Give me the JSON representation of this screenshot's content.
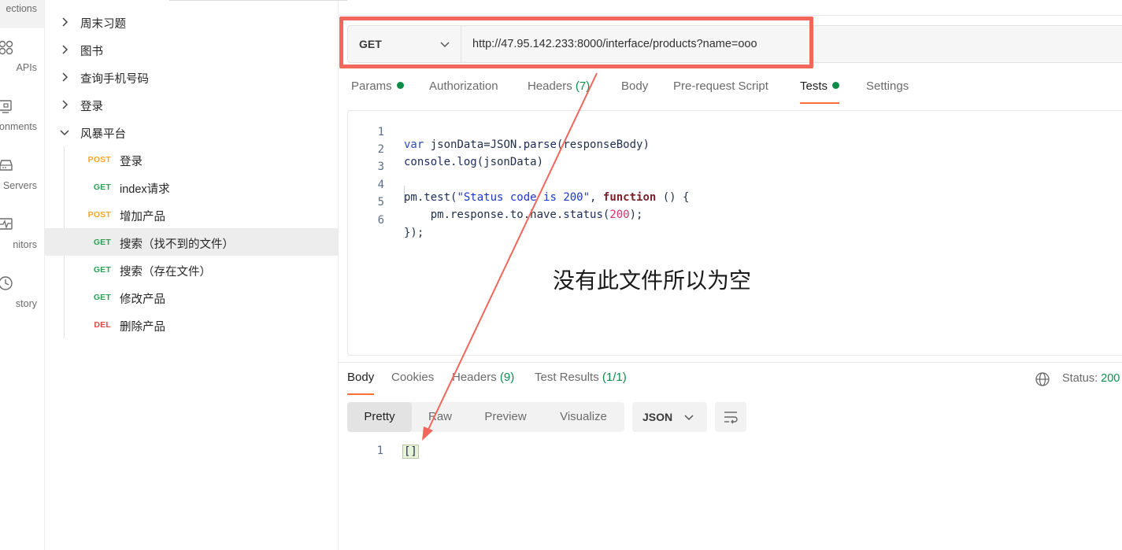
{
  "rail": {
    "items": [
      {
        "label": "ections",
        "icon": "collections-icon"
      },
      {
        "label": "APIs",
        "icon": "apis-icon"
      },
      {
        "label": "onments",
        "icon": "environments-icon"
      },
      {
        "label": "Servers",
        "icon": "mock-servers-icon"
      },
      {
        "label": "nitors",
        "icon": "monitors-icon"
      },
      {
        "label": "story",
        "icon": "history-icon"
      }
    ]
  },
  "tree": {
    "folders": [
      {
        "label": "周末习题",
        "expanded": false
      },
      {
        "label": "图书",
        "expanded": false
      },
      {
        "label": "查询手机号码",
        "expanded": false
      },
      {
        "label": "登录",
        "expanded": false
      },
      {
        "label": "风暴平台",
        "expanded": true
      }
    ],
    "requests": [
      {
        "method": "POST",
        "name": "登录"
      },
      {
        "method": "GET",
        "name": "index请求"
      },
      {
        "method": "POST",
        "name": "增加产品"
      },
      {
        "method": "GET",
        "name": "搜索（找不到的文件）",
        "selected": true
      },
      {
        "method": "GET",
        "name": "搜索（存在文件）"
      },
      {
        "method": "GET",
        "name": "修改产品"
      },
      {
        "method": "DEL",
        "name": "删除产品"
      }
    ]
  },
  "request": {
    "method": "GET",
    "url": "http://47.95.142.233:8000/interface/products?name=ooo",
    "tabs": {
      "params": "Params",
      "authorization": "Authorization",
      "headers": "Headers",
      "headers_count": "(7)",
      "body": "Body",
      "prerequest": "Pre-request Script",
      "tests": "Tests",
      "settings": "Settings"
    },
    "active_tab": "Tests"
  },
  "editor": {
    "line_numbers": [
      "1",
      "2",
      "3",
      "4",
      "5",
      "6"
    ],
    "l1": {
      "kw": "var",
      "rest_a": " jsonData=JSON.",
      "fn": "parse",
      "rest_b": "(responseBody)"
    },
    "l2": {
      "fn": "console.log",
      "rest": "(jsonData)"
    },
    "l4": {
      "a": "pm.",
      "fn": "test",
      "b": "(",
      "str": "\"Status code is 200\"",
      "c": ", ",
      "kw": "function",
      "d": " () {"
    },
    "l5": {
      "a": "    pm.response.to.have.",
      "fn": "status",
      "b": "(",
      "num": "200",
      "c": ");"
    },
    "l6": {
      "a": "});"
    }
  },
  "annotation": {
    "text": "没有此文件所以为空"
  },
  "response": {
    "tabs": {
      "body": "Body",
      "cookies": "Cookies",
      "headers": "Headers",
      "headers_count": "(9)",
      "test_results": "Test Results",
      "test_results_count": "(1/1)"
    },
    "status_label": "Status:",
    "status_value": "200",
    "views": [
      "Pretty",
      "Raw",
      "Preview",
      "Visualize"
    ],
    "active_view": "Pretty",
    "format": "JSON",
    "body_line_number": "1",
    "body_value": "[]"
  },
  "colors": {
    "accent": "#ff6c37",
    "highlight_annotation": "#f2665b",
    "method_post": "#f5a623",
    "method_get": "#2e9e58",
    "method_del": "#e0484b",
    "success": "#0f8c4a"
  }
}
